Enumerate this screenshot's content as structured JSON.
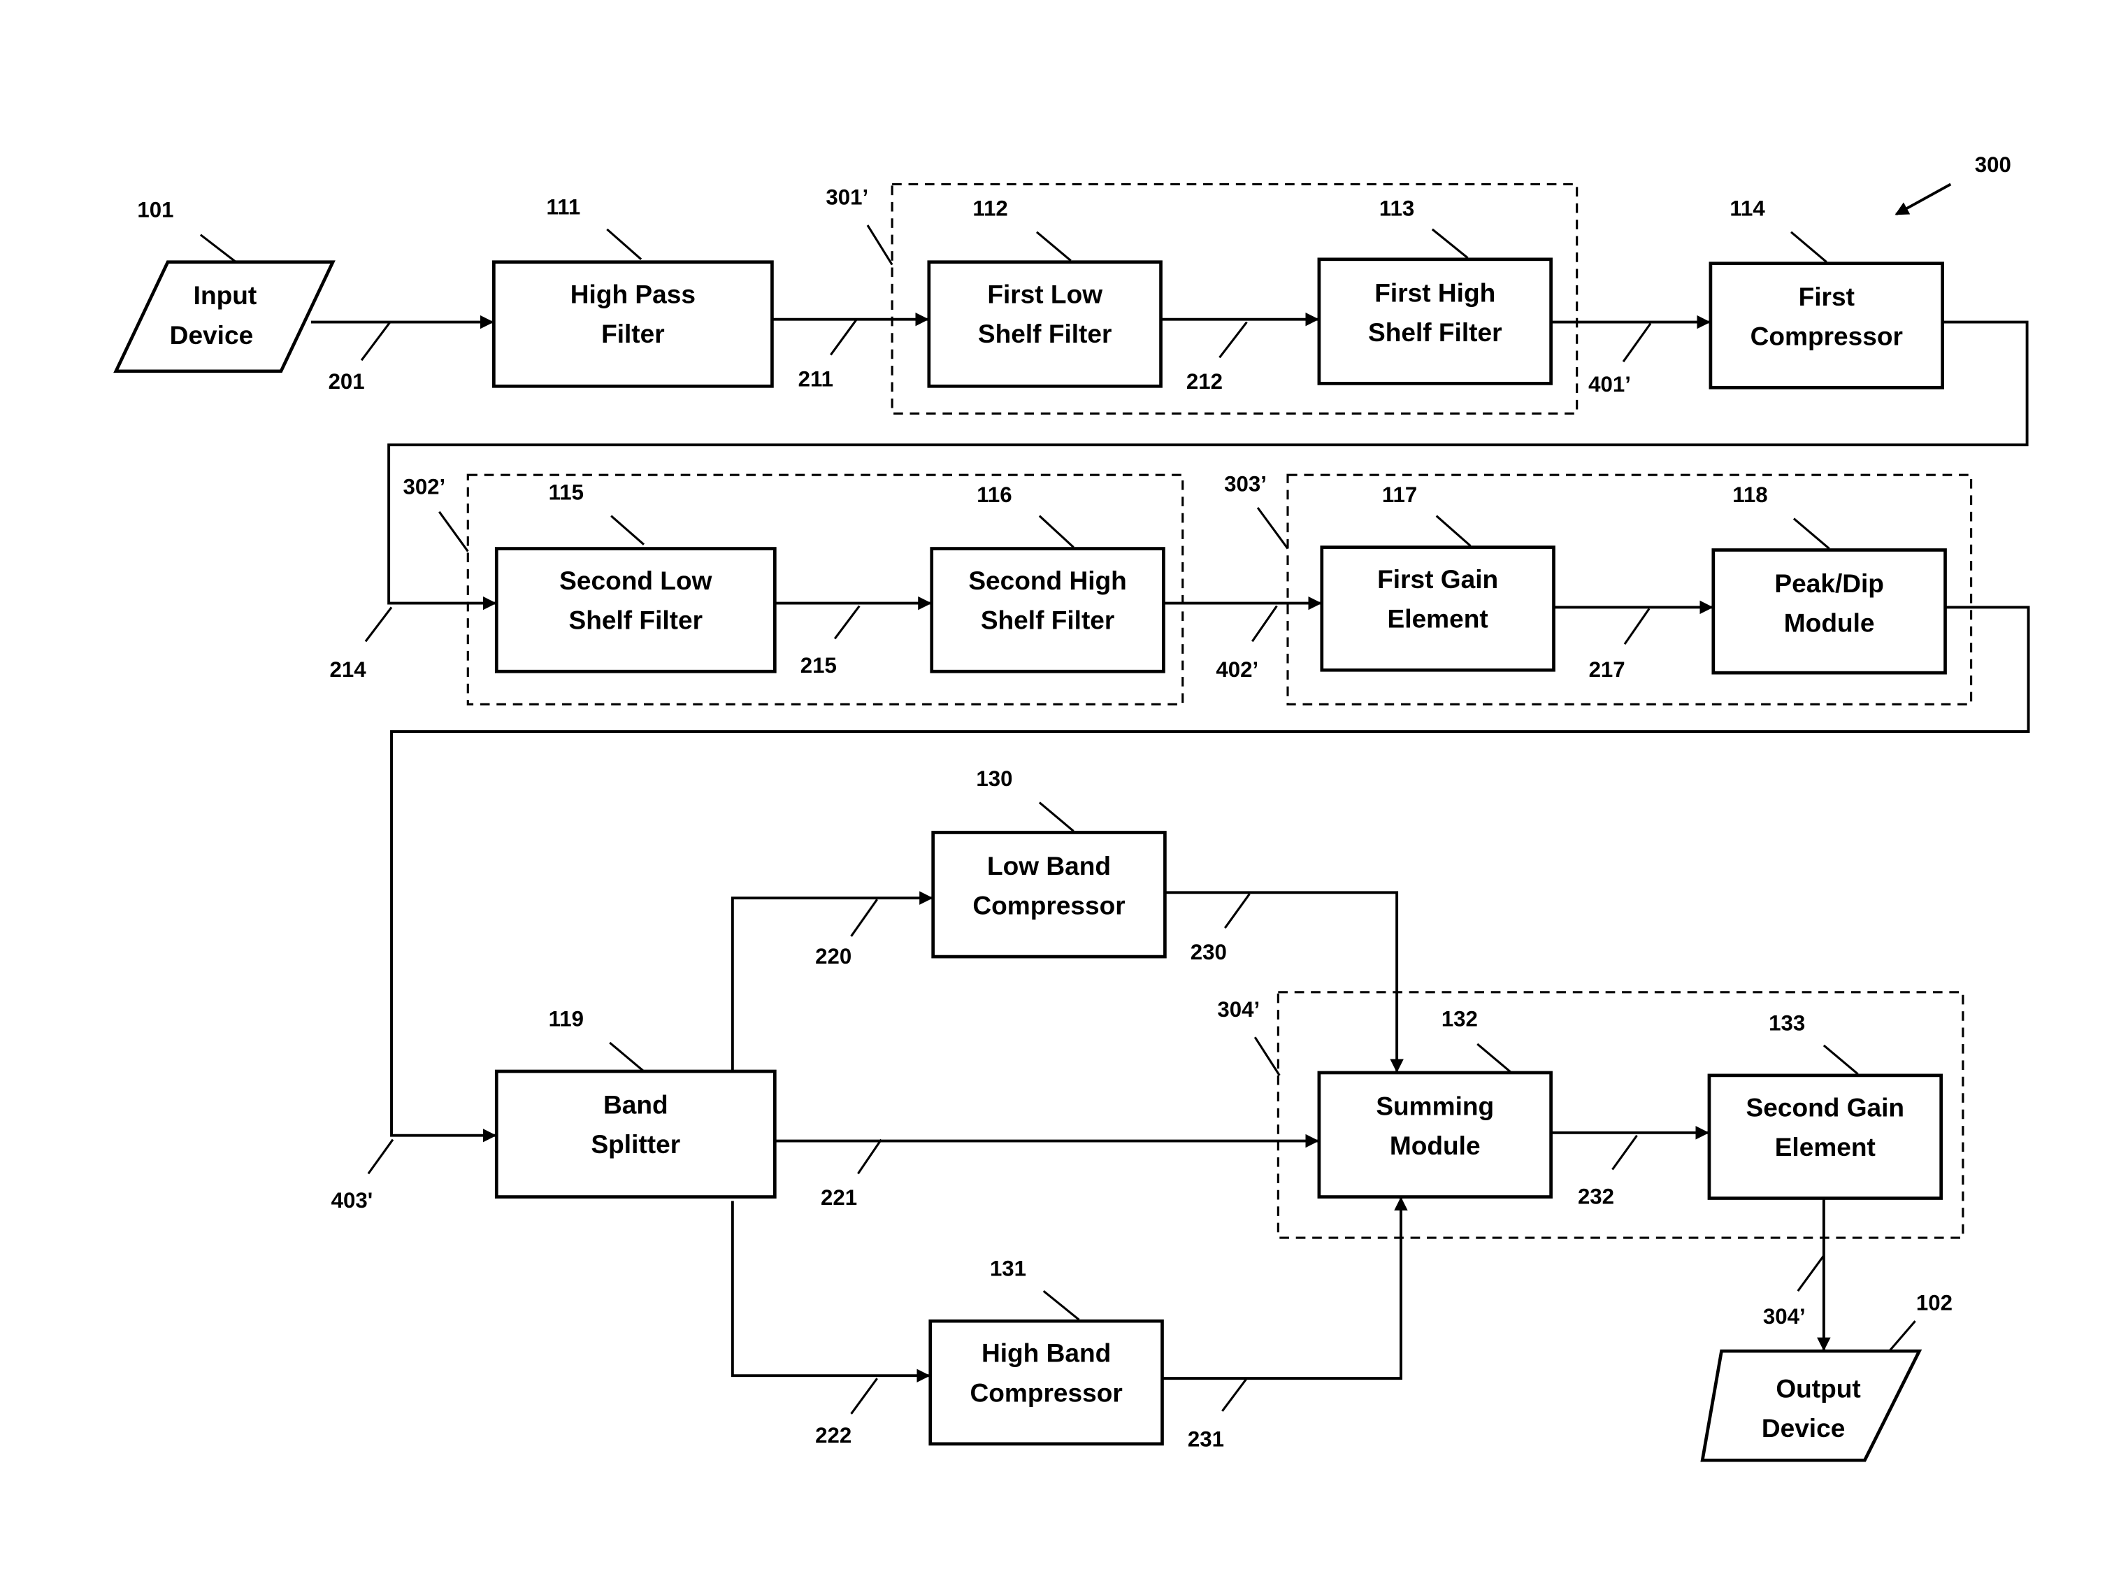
{
  "figure": {
    "reference": "300",
    "background_color": "#ffffff",
    "line_color": "#000000"
  },
  "blocks": {
    "input_device": {
      "ref": "101",
      "line1": "Input",
      "line2": "Device"
    },
    "high_pass_filter": {
      "ref": "111",
      "line1": "High Pass",
      "line2": "Filter"
    },
    "first_low_shelf_filter": {
      "ref": "112",
      "line1": "First Low",
      "line2": "Shelf Filter"
    },
    "first_high_shelf_filter": {
      "ref": "113",
      "line1": "First High",
      "line2": "Shelf Filter"
    },
    "first_compressor": {
      "ref": "114",
      "line1": "First",
      "line2": "Compressor"
    },
    "second_low_shelf_filter": {
      "ref": "115",
      "line1": "Second Low",
      "line2": "Shelf Filter"
    },
    "second_high_shelf_filter": {
      "ref": "116",
      "line1": "Second High",
      "line2": "Shelf Filter"
    },
    "first_gain_element": {
      "ref": "117",
      "line1": "First Gain",
      "line2": "Element"
    },
    "peak_dip_module": {
      "ref": "118",
      "line1": "Peak/Dip",
      "line2": "Module"
    },
    "band_splitter": {
      "ref": "119",
      "line1": "Band",
      "line2": "Splitter"
    },
    "low_band_compressor": {
      "ref": "130",
      "line1": "Low Band",
      "line2": "Compressor"
    },
    "high_band_compressor": {
      "ref": "131",
      "line1": "High Band",
      "line2": "Compressor"
    },
    "summing_module": {
      "ref": "132",
      "line1": "Summing",
      "line2": "Module"
    },
    "second_gain_element": {
      "ref": "133",
      "line1": "Second Gain",
      "line2": "Element"
    },
    "output_device": {
      "ref": "102",
      "line1": "Output",
      "line2": "Device"
    }
  },
  "groups": {
    "group_301": "301’",
    "group_302": "302’",
    "group_303": "303’",
    "group_304": "304’"
  },
  "signals": {
    "s201": "201",
    "s211": "211",
    "s212": "212",
    "s401": "401’",
    "s214": "214",
    "s215": "215",
    "s402": "402’",
    "s217": "217",
    "s403": "403'",
    "s220": "220",
    "s221": "221",
    "s222": "222",
    "s230": "230",
    "s231": "231",
    "s232": "232",
    "s304_out": "304’"
  }
}
